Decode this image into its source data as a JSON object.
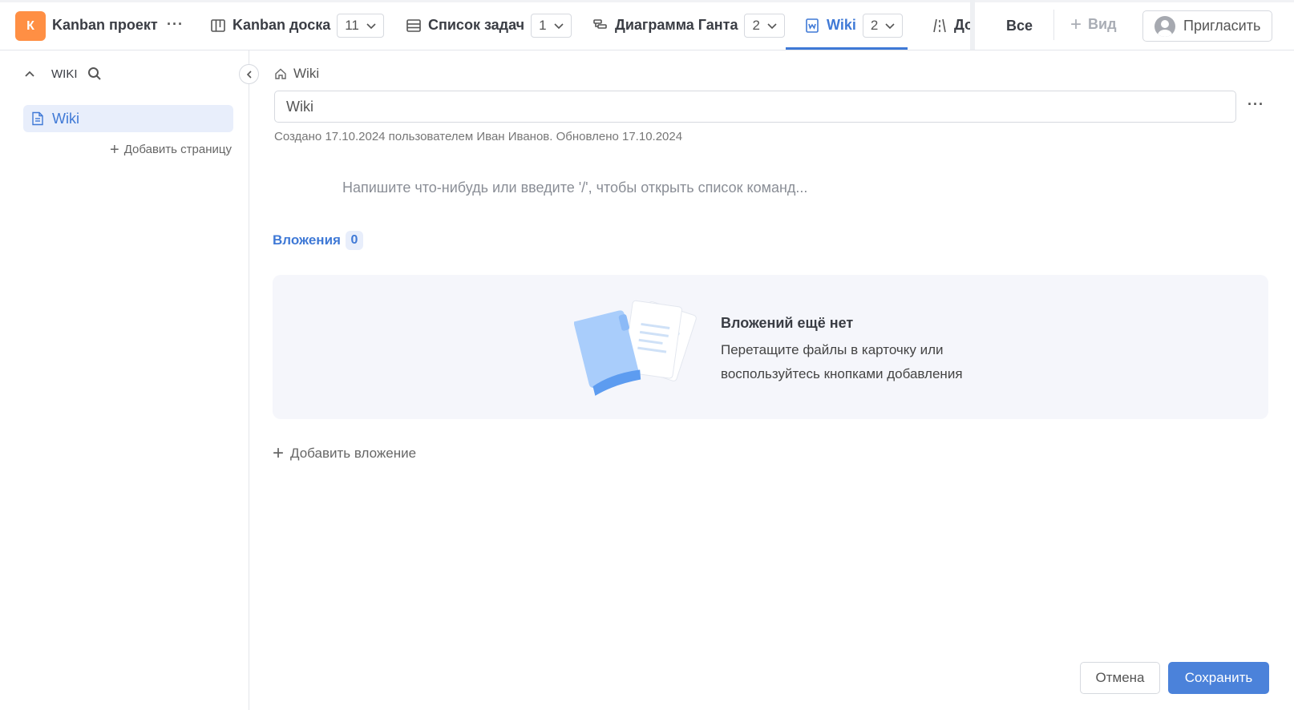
{
  "header": {
    "project_initial": "К",
    "project_name": "Kanban проект",
    "more": "···",
    "tabs": [
      {
        "label": "Kanban доска",
        "count": "11",
        "icon": "kanban-board-icon"
      },
      {
        "label": "Список задач",
        "count": "1",
        "icon": "task-list-icon"
      },
      {
        "label": "Диаграмма Ганта",
        "count": "2",
        "icon": "gantt-chart-icon"
      },
      {
        "label": "Wiki",
        "count": "2",
        "icon": "wiki-icon",
        "active": true
      },
      {
        "label": "Дорожі",
        "icon": "roadmap-icon"
      }
    ],
    "all_label": "Все",
    "add_view_label": "Вид",
    "invite_label": "Пригласить"
  },
  "sidebar": {
    "title": "WIKI",
    "items": [
      {
        "label": "Wiki",
        "icon": "document-icon"
      }
    ],
    "add_page_label": "Добавить страницу"
  },
  "page": {
    "breadcrumb": "Wiki",
    "title_value": "Wiki",
    "more": "···",
    "meta": "Создано 17.10.2024 пользователем Иван Иванов. Обновлено 17.10.2024",
    "editor_placeholder": "Напишите что-нибудь или введите '/', чтобы открыть список команд..."
  },
  "attachments": {
    "heading": "Вложения",
    "count": "0",
    "empty_title": "Вложений ещё нет",
    "empty_desc_line1": "Перетащите файлы в карточку или",
    "empty_desc_line2": "воспользуйтесь кнопками добавления",
    "add_label": "Добавить вложение"
  },
  "footer": {
    "cancel_label": "Отмена",
    "save_label": "Сохранить"
  },
  "colors": {
    "accent": "#3f79d6",
    "project_logo": "#ff8f44",
    "save_button": "#4b82da"
  }
}
